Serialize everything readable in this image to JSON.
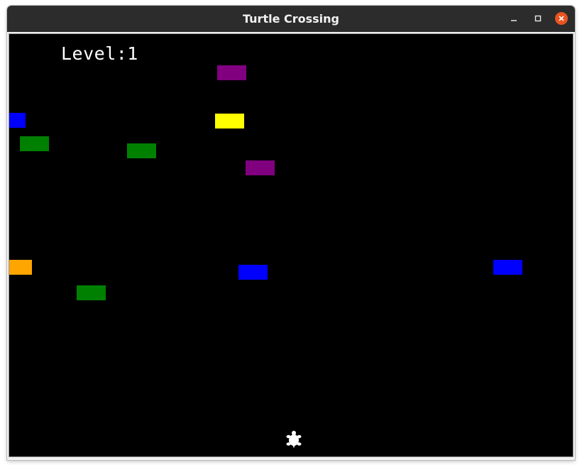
{
  "window": {
    "title": "Turtle Crossing",
    "controls": {
      "minimize_icon": "minimize-icon",
      "maximize_icon": "maximize-icon",
      "close_icon": "close-icon",
      "close_color": "#e95420"
    }
  },
  "game": {
    "background": "#000000",
    "scoreboard": {
      "level_text": "Level:1"
    },
    "cars": [
      {
        "color": "#800080",
        "name": "purple"
      },
      {
        "color": "#ffff00",
        "name": "yellow"
      },
      {
        "color": "#0000ff",
        "name": "blue"
      },
      {
        "color": "#008000",
        "name": "green"
      },
      {
        "color": "#008000",
        "name": "green"
      },
      {
        "color": "#800080",
        "name": "purple"
      },
      {
        "color": "#ffa500",
        "name": "orange"
      },
      {
        "color": "#0000ff",
        "name": "blue"
      },
      {
        "color": "#0000ff",
        "name": "blue"
      },
      {
        "color": "#008000",
        "name": "green"
      }
    ],
    "player": {
      "icon": "turtle-icon",
      "color": "#ffffff"
    }
  }
}
